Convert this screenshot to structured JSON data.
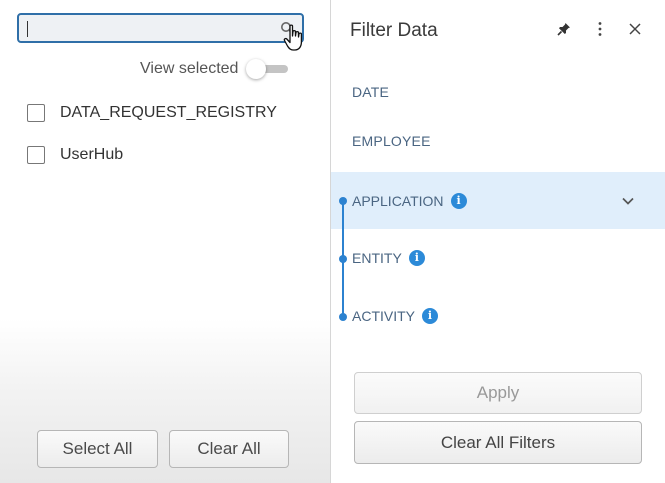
{
  "left_panel": {
    "search": {
      "value": "",
      "placeholder": ""
    },
    "view_selected_label": "View selected",
    "view_selected_on": false,
    "items": [
      {
        "label": "DATA_REQUEST_REGISTRY",
        "checked": false
      },
      {
        "label": "UserHub",
        "checked": false
      }
    ],
    "select_all_label": "Select All",
    "clear_all_label": "Clear All"
  },
  "right_panel": {
    "title": "Filter Data",
    "filters": [
      {
        "label": "DATE",
        "info": false,
        "active": false
      },
      {
        "label": "EMPLOYEE",
        "info": false,
        "active": false
      },
      {
        "label": "APPLICATION",
        "info": true,
        "active": true
      },
      {
        "label": "ENTITY",
        "info": true,
        "active": false
      },
      {
        "label": "ACTIVITY",
        "info": true,
        "active": false
      }
    ],
    "apply_label": "Apply",
    "clear_filters_label": "Clear All Filters"
  },
  "colors": {
    "accent": "#2c82d0",
    "active_row": "#e0eefb",
    "filter_label": "#4a6582",
    "search_border": "#2f6fa8"
  },
  "icons": [
    "search-icon",
    "hand-cursor-icon",
    "pin-icon",
    "more-vertical-icon",
    "close-icon",
    "info-icon",
    "chevron-down-icon"
  ]
}
